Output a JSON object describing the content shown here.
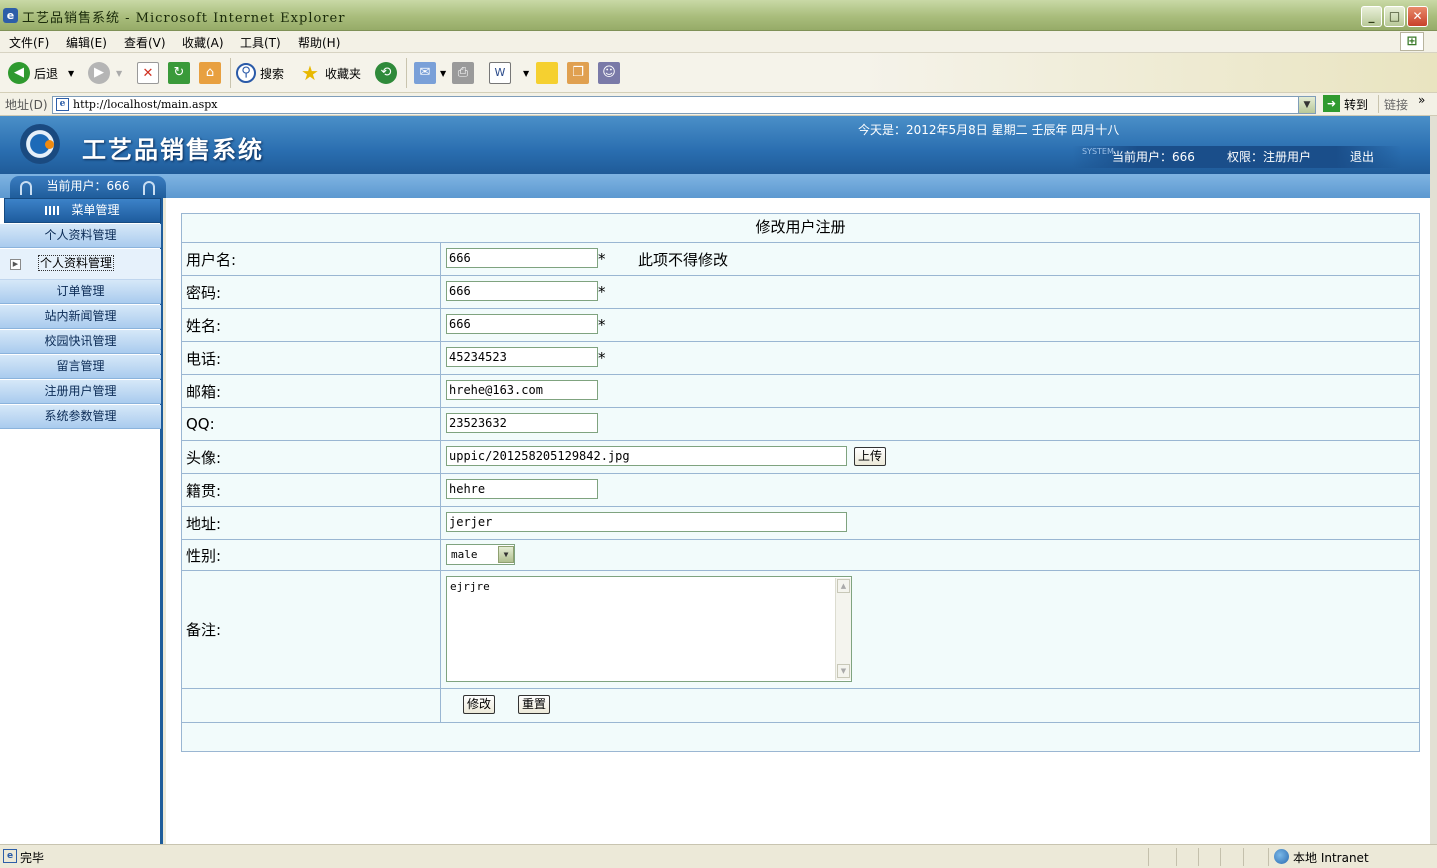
{
  "window": {
    "title": "工艺品销售系统 - Microsoft Internet Explorer"
  },
  "menubar": {
    "items": [
      "文件(F)",
      "编辑(E)",
      "查看(V)",
      "收藏(A)",
      "工具(T)",
      "帮助(H)"
    ]
  },
  "toolbar": {
    "back_label": "后退",
    "search_label": "搜索",
    "favorites_label": "收藏夹"
  },
  "address": {
    "label": "地址(D)",
    "url": "http://localhost/main.aspx",
    "go_label": "转到",
    "links_label": "链接"
  },
  "header": {
    "system_name": "工艺品销售系统",
    "date_text": "今天是：2012年5月8日  星期二  壬辰年  四月十八",
    "system_word": "SYSTEM",
    "current_user": "当前用户：666",
    "permission": "权限：注册用户",
    "logout": "退出"
  },
  "sidebar": {
    "current_user": "当前用户：666",
    "menu_title": "菜单管理",
    "items": [
      {
        "label": "个人资料管理"
      },
      {
        "label": "个人资料管理",
        "selected": true
      },
      {
        "label": "订单管理"
      },
      {
        "label": "站内新闻管理"
      },
      {
        "label": "校园快讯管理"
      },
      {
        "label": "留言管理"
      },
      {
        "label": "注册用户管理"
      },
      {
        "label": "系统参数管理"
      }
    ]
  },
  "form": {
    "title": "修改用户注册",
    "star": "*",
    "username": {
      "label": "用户名:",
      "value": "666",
      "note": "此项不得修改"
    },
    "password": {
      "label": "密码:",
      "value": "666"
    },
    "name": {
      "label": "姓名:",
      "value": "666"
    },
    "phone": {
      "label": "电话:",
      "value": "45234523"
    },
    "email": {
      "label": "邮箱:",
      "value": "hrehe@163.com"
    },
    "qq": {
      "label": "QQ:",
      "value": "23523632"
    },
    "avatar": {
      "label": "头像:",
      "value": "uppic/201258205129842.jpg",
      "upload_label": "上传"
    },
    "hometown": {
      "label": "籍贯:",
      "value": "hehre"
    },
    "address": {
      "label": "地址:",
      "value": "jerjer"
    },
    "gender": {
      "label": "性别:",
      "value": "male"
    },
    "remark": {
      "label": "备注:",
      "value": "ejrjre"
    },
    "submit_label": "修改",
    "reset_label": "重置"
  },
  "statusbar": {
    "status": "完毕",
    "zone": "本地 Intranet"
  }
}
